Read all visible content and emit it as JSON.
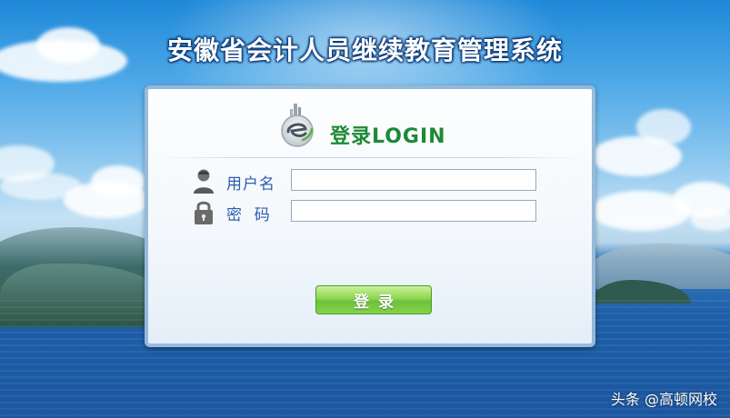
{
  "app": {
    "title": "安徽省会计人员继续教育管理系统"
  },
  "login": {
    "heading": "登录LOGIN",
    "username_label": "用户名",
    "username_value": "",
    "password_label": "密  码",
    "password_value": "",
    "submit_label": "登录"
  },
  "watermark": {
    "text": "头条 @高顿网校"
  },
  "colors": {
    "heading_green": "#1c8a36",
    "label_blue": "#2a5db0",
    "button_green": "#6cc23a"
  },
  "icons": {
    "logo": "site-logo-icon",
    "user": "user-icon",
    "lock": "lock-icon"
  }
}
